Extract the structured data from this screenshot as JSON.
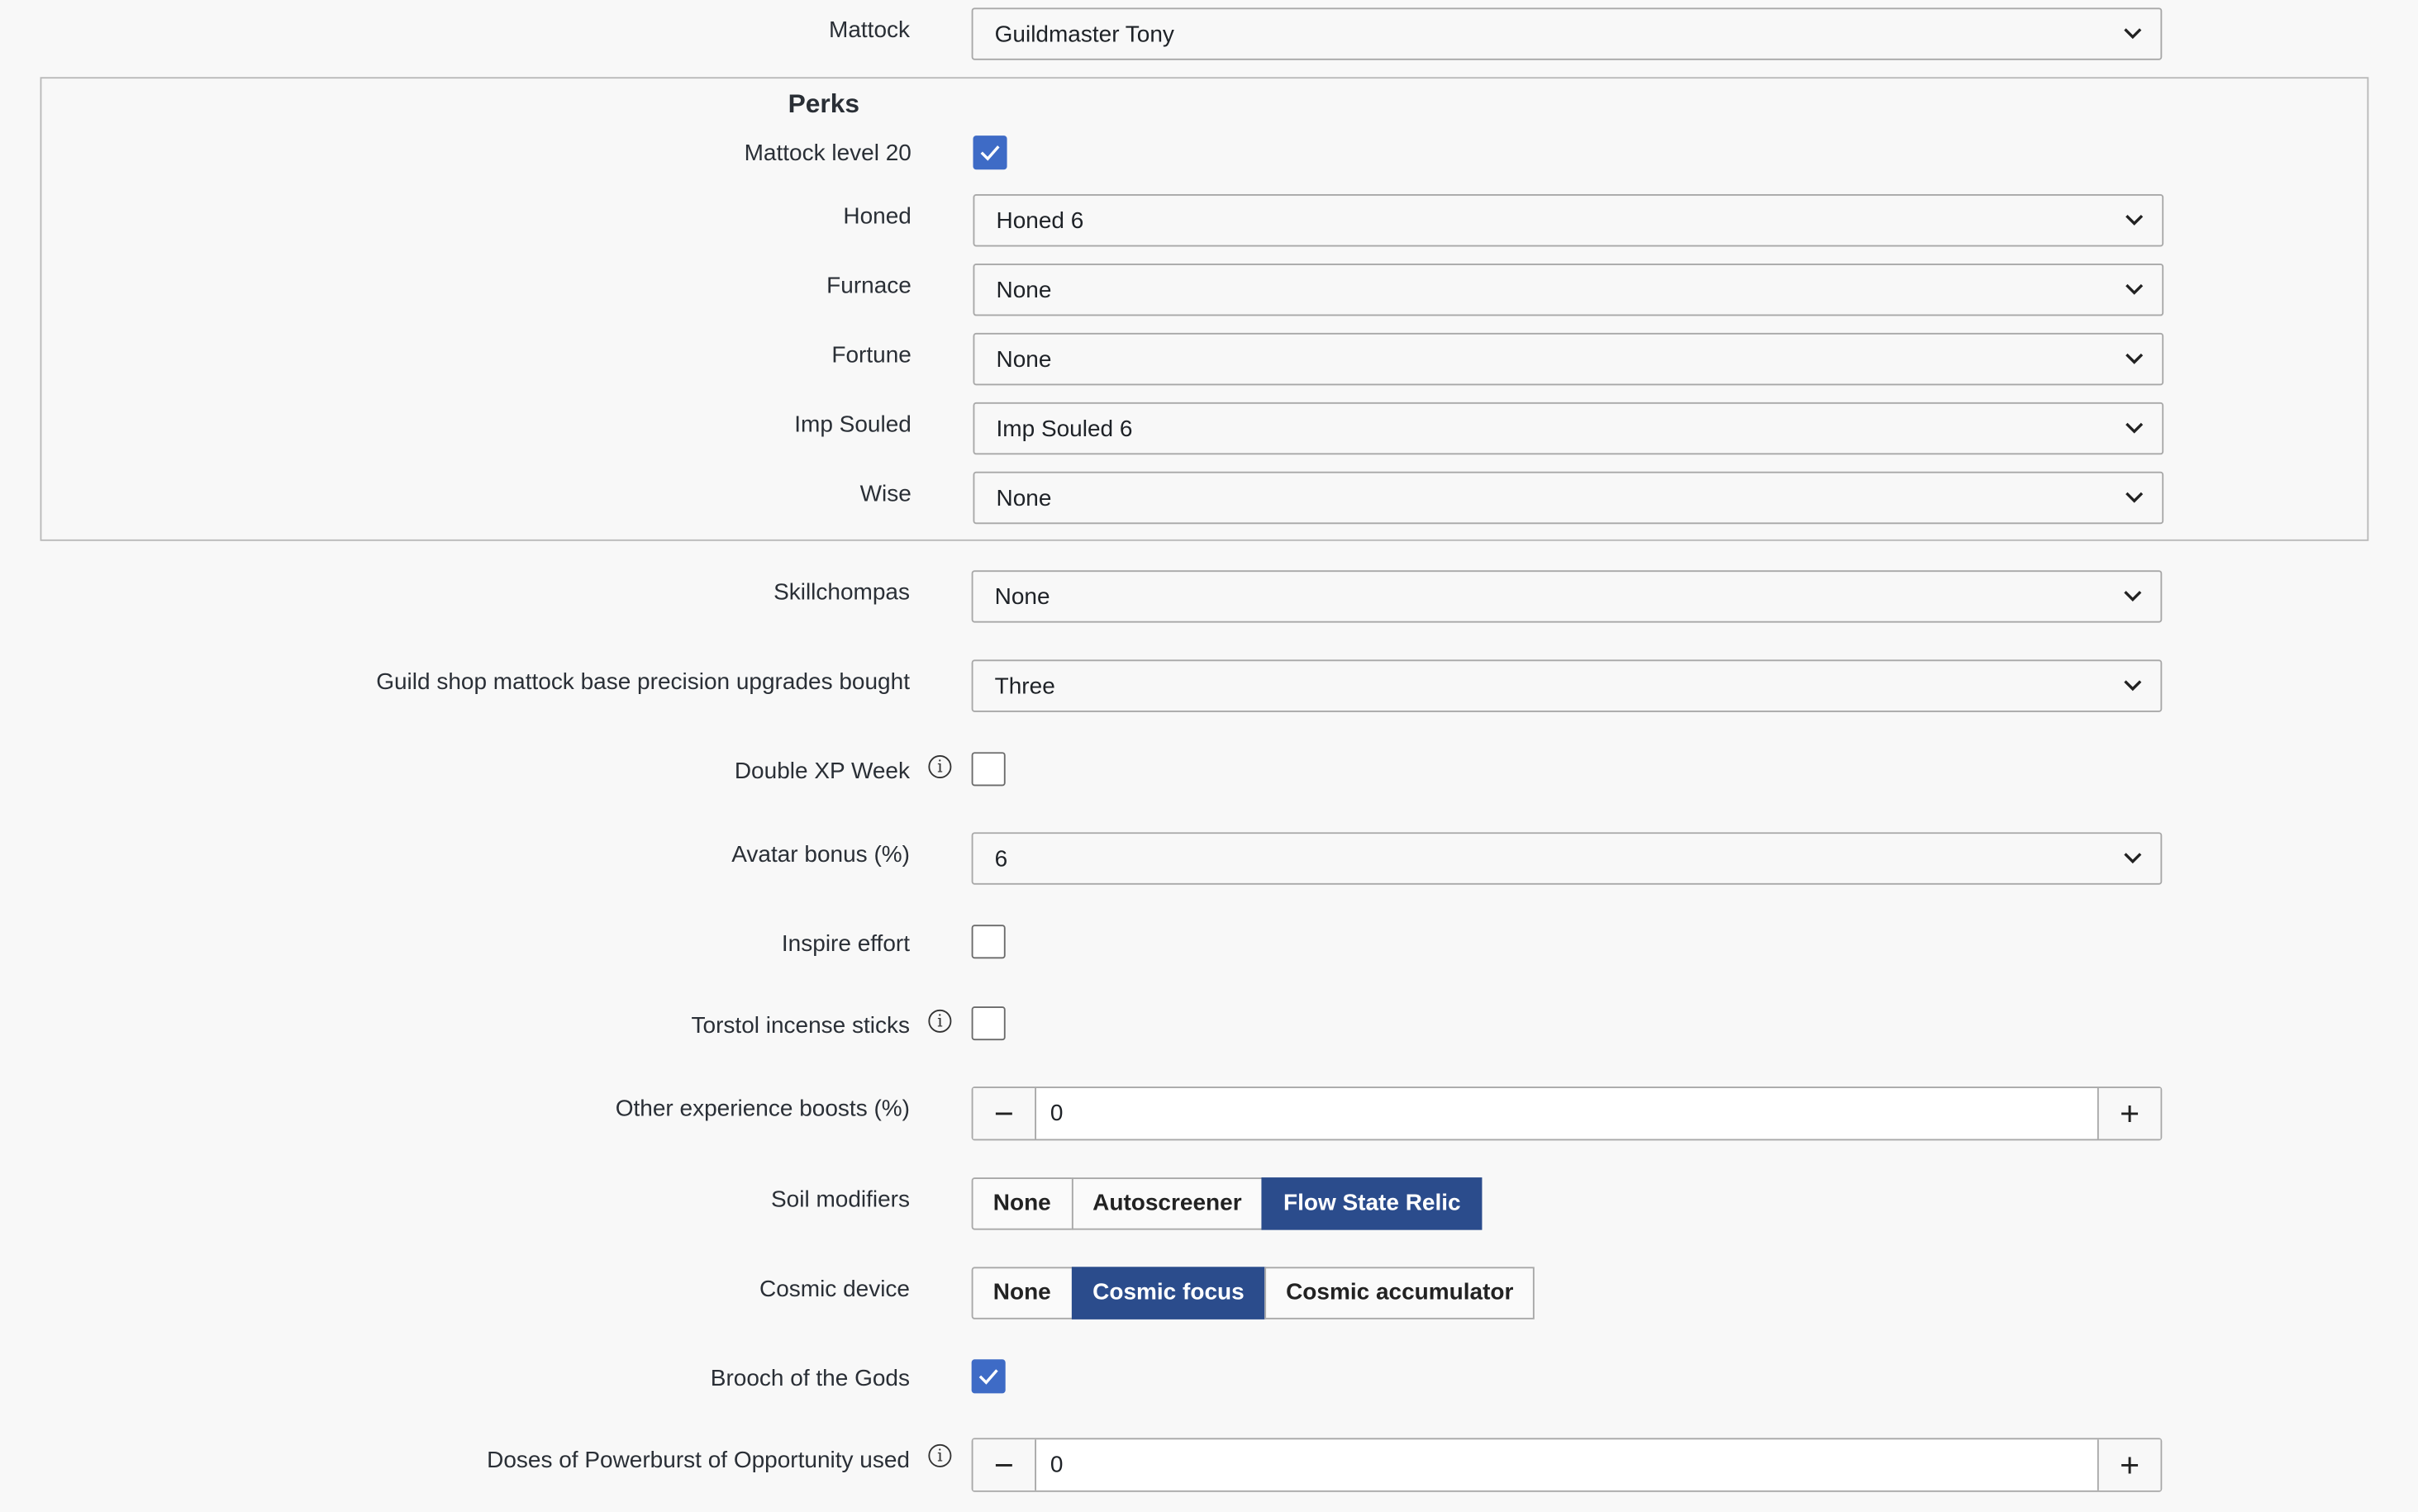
{
  "mattock": {
    "label": "Mattock",
    "value": "Guildmaster Tony"
  },
  "perks": {
    "legend": "Perks",
    "level20": {
      "label": "Mattock level 20",
      "checked": true
    },
    "honed": {
      "label": "Honed",
      "value": "Honed 6"
    },
    "furnace": {
      "label": "Furnace",
      "value": "None"
    },
    "fortune": {
      "label": "Fortune",
      "value": "None"
    },
    "imp_souled": {
      "label": "Imp Souled",
      "value": "Imp Souled 6"
    },
    "wise": {
      "label": "Wise",
      "value": "None"
    }
  },
  "skillchompas": {
    "label": "Skillchompas",
    "value": "None"
  },
  "guild_shop": {
    "label": "Guild shop mattock base precision upgrades bought",
    "value": "Three"
  },
  "double_xp": {
    "label": "Double XP Week",
    "checked": false
  },
  "avatar_bonus": {
    "label": "Avatar bonus (%)",
    "value": "6"
  },
  "inspire_effort": {
    "label": "Inspire effort",
    "checked": false
  },
  "torstol": {
    "label": "Torstol incense sticks",
    "checked": false
  },
  "other_boosts": {
    "label": "Other experience boosts (%)",
    "value": "0"
  },
  "soil_modifiers": {
    "label": "Soil modifiers",
    "options": [
      "None",
      "Autoscreener",
      "Flow State Relic"
    ],
    "selected": "Flow State Relic"
  },
  "cosmic_device": {
    "label": "Cosmic device",
    "options": [
      "None",
      "Cosmic focus",
      "Cosmic accumulator"
    ],
    "selected": "Cosmic focus"
  },
  "brooch": {
    "label": "Brooch of the Gods",
    "checked": true
  },
  "powerburst": {
    "label": "Doses of Powerburst of Opportunity used",
    "value": "0"
  },
  "icons": {
    "info": "i",
    "minus": "−",
    "plus": "+"
  },
  "colors": {
    "accent": "#2b4c8c",
    "checkbox": "#3e6bc6"
  }
}
